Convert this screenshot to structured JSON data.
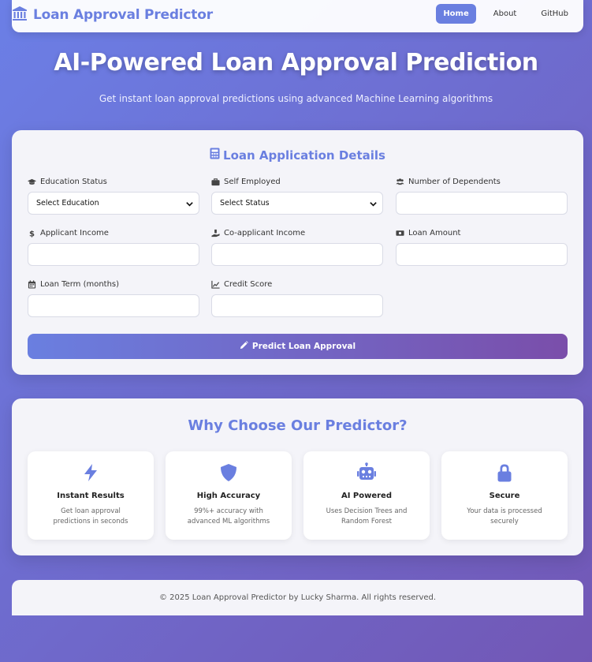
{
  "navbar": {
    "brand": "Loan Approval Predictor",
    "brand_icon": "bank-icon",
    "links": [
      "Home",
      "About",
      "GitHub"
    ],
    "accent_color": "#6a7fe0"
  },
  "hero": {
    "title": "AI-Powered Loan Approval Prediction",
    "subtitle": "Get instant loan approval predictions using advanced Machine Learning algorithms"
  },
  "form": {
    "title": "Loan Application Details",
    "fields": {
      "education": {
        "label": "Education Status",
        "value": "Select Education",
        "icon": "graduation-cap-icon"
      },
      "self_employed": {
        "label": "Self Employed",
        "value": "Select Status",
        "icon": "briefcase-icon"
      },
      "dependents": {
        "label": "Number of Dependents",
        "value": "",
        "icon": "users-icon"
      },
      "applicant_income": {
        "label": "Applicant Income",
        "value": "",
        "icon": "dollar-icon"
      },
      "coapplicant_income": {
        "label": "Co-applicant Income",
        "value": "",
        "icon": "hand-holding-icon"
      },
      "loan_amount": {
        "label": "Loan Amount",
        "value": "",
        "icon": "money-bill-icon"
      },
      "loan_term": {
        "label": "Loan Term (months)",
        "value": "",
        "icon": "calendar-icon"
      },
      "credit_score": {
        "label": "Credit Score",
        "value": "",
        "icon": "chart-line-icon"
      }
    },
    "submit_label": "Predict Loan Approval"
  },
  "features": {
    "title": "Why Choose Our Predictor?",
    "items": [
      {
        "title": "Instant Results",
        "desc": "Get loan approval predictions in seconds",
        "icon": "bolt-icon"
      },
      {
        "title": "High Accuracy",
        "desc": "99%+ accuracy with advanced ML algorithms",
        "icon": "shield-icon"
      },
      {
        "title": "AI Powered",
        "desc": "Uses Decision Trees and Random Forest",
        "icon": "robot-icon"
      },
      {
        "title": "Secure",
        "desc": "Your data is processed securely",
        "icon": "lock-icon"
      }
    ]
  },
  "footer": {
    "text": "© 2025 Loan Approval Predictor by Lucky Sharma. All rights reserved."
  }
}
